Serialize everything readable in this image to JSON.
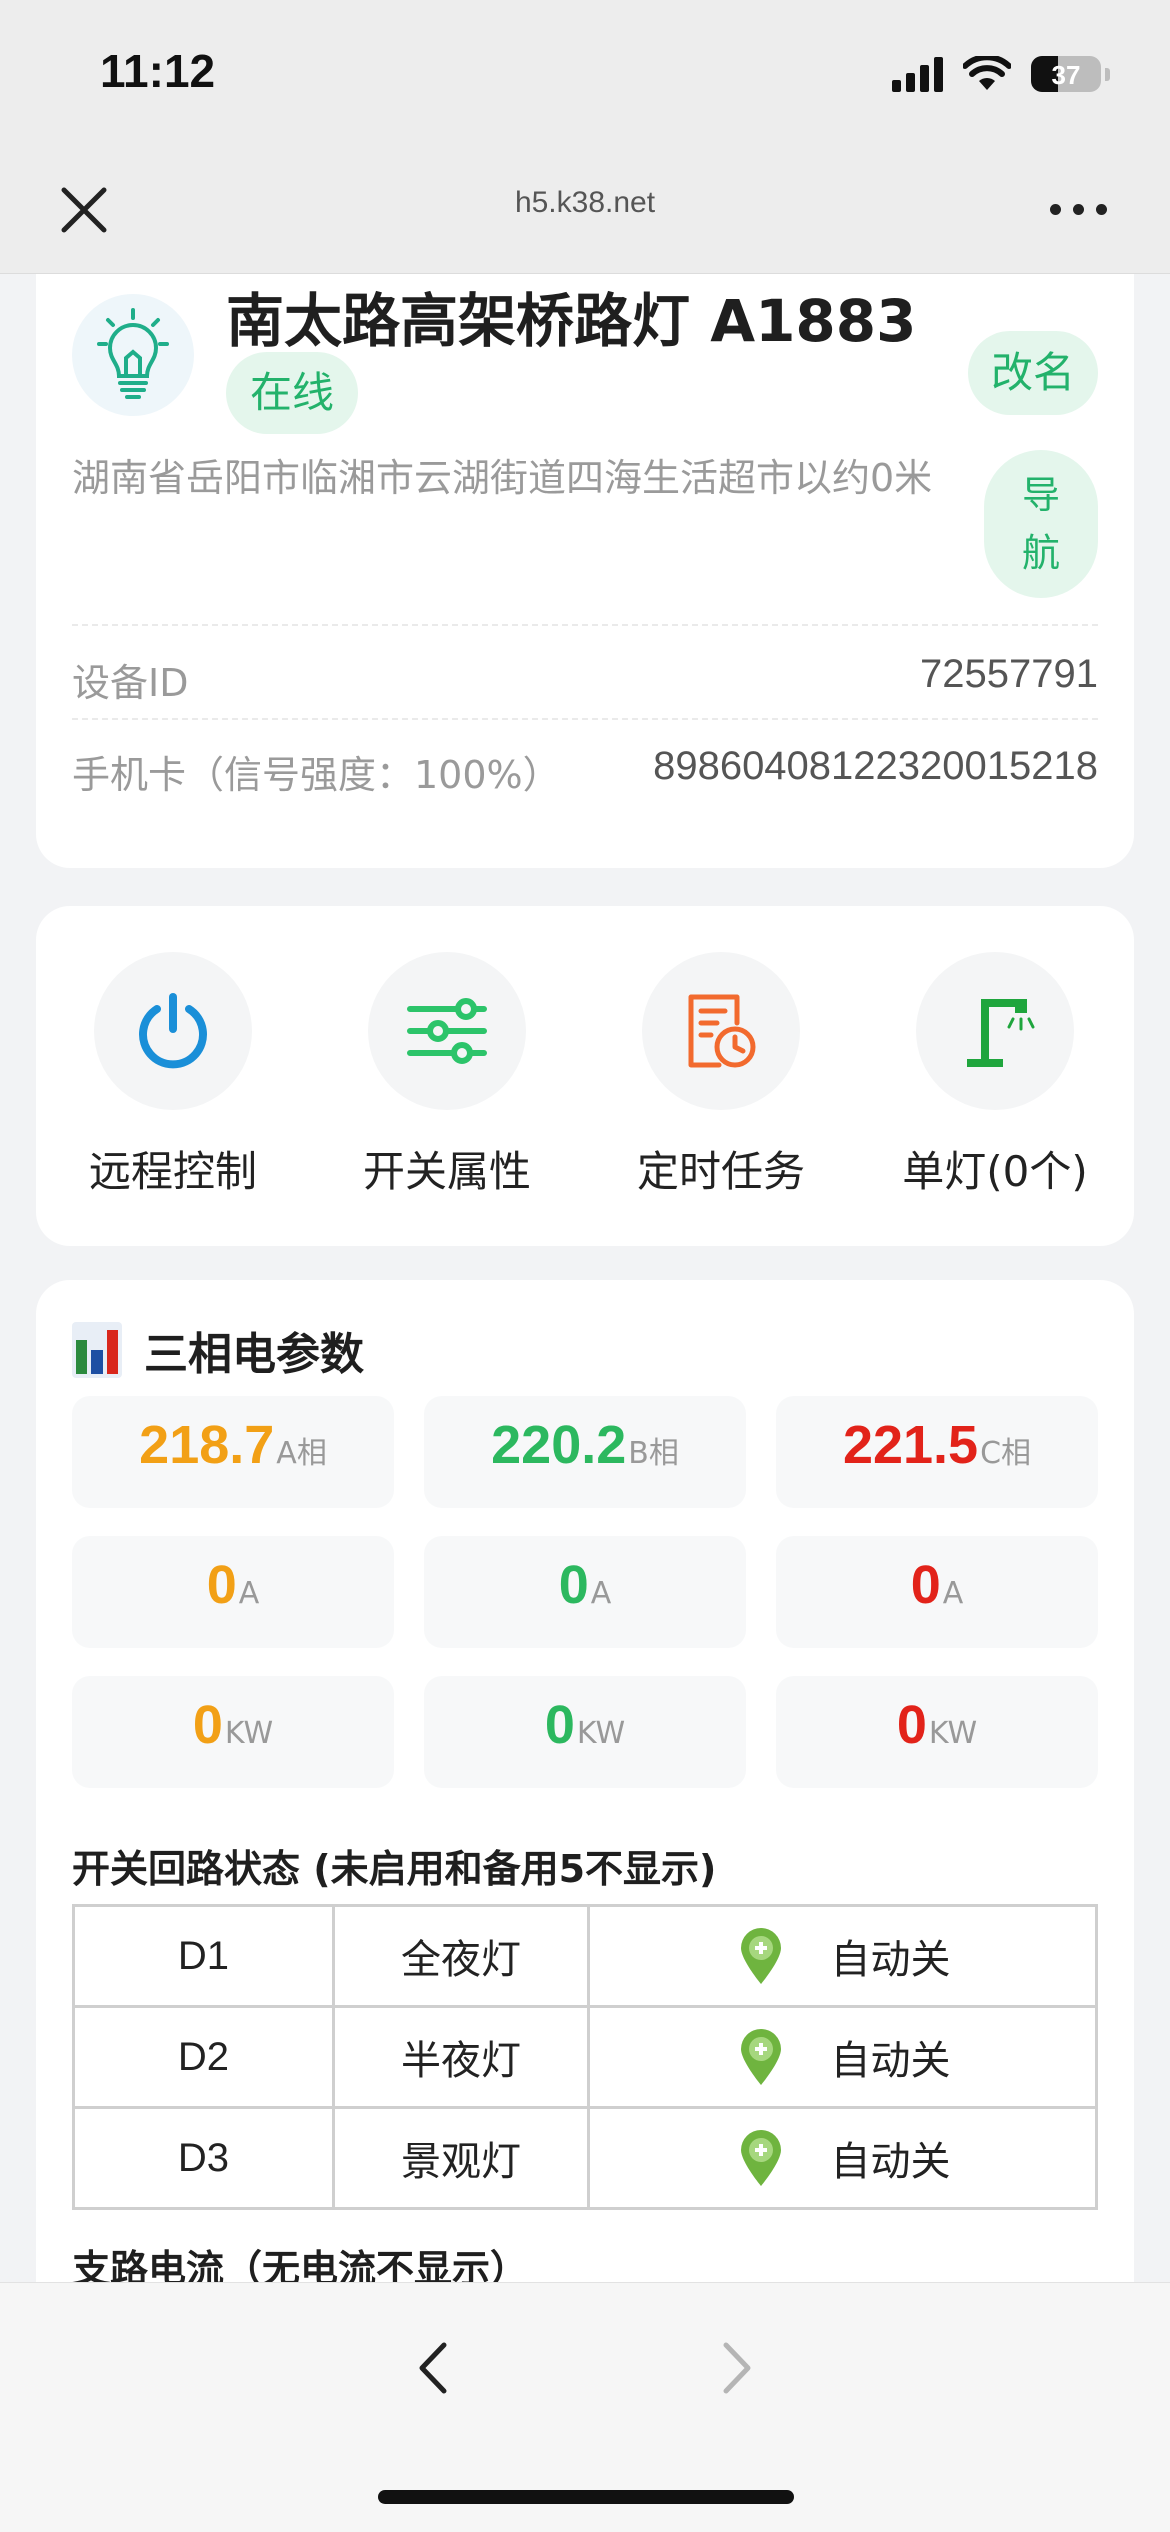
{
  "status_bar": {
    "time": "11:12",
    "battery": "37"
  },
  "browser": {
    "url": "h5.k38.net"
  },
  "device": {
    "name": "南太路高架桥路灯 A1883",
    "status": "在线",
    "rename_label": "改名",
    "address": "湖南省岳阳市临湘市云湖街道四海生活超市以约0米",
    "nav_label_1": "导",
    "nav_label_2": "航",
    "id_label": "设备ID",
    "id_value": "72557791",
    "sim_label": "手机卡（信号强度：100%）",
    "sim_value": "89860408122320015218"
  },
  "functions": [
    {
      "label": "远程控制",
      "icon": "power-icon"
    },
    {
      "label": "开关属性",
      "icon": "sliders-icon"
    },
    {
      "label": "定时任务",
      "icon": "schedule-icon"
    },
    {
      "label": "单灯(0个)",
      "icon": "streetlight-icon"
    }
  ],
  "params": {
    "title": "三相电参数",
    "voltage": [
      {
        "value": "218.7",
        "unit": "A相"
      },
      {
        "value": "220.2",
        "unit": "B相"
      },
      {
        "value": "221.5",
        "unit": "C相"
      }
    ],
    "current": [
      {
        "value": "0",
        "unit": "A"
      },
      {
        "value": "0",
        "unit": "A"
      },
      {
        "value": "0",
        "unit": "A"
      }
    ],
    "power": [
      {
        "value": "0",
        "unit": "KW"
      },
      {
        "value": "0",
        "unit": "KW"
      },
      {
        "value": "0",
        "unit": "KW"
      }
    ],
    "phase_colors": [
      "#f2a016",
      "#2cb85f",
      "#e2231a"
    ]
  },
  "loops": {
    "title": "开关回路状态 (未启用和备用5不显示)",
    "rows": [
      {
        "id": "D1",
        "name": "全夜灯",
        "state": "自动关"
      },
      {
        "id": "D2",
        "name": "半夜灯",
        "state": "自动关"
      },
      {
        "id": "D3",
        "name": "景观灯",
        "state": "自动关"
      }
    ]
  },
  "branch": {
    "title": "支路电流（无电流不显示）"
  }
}
